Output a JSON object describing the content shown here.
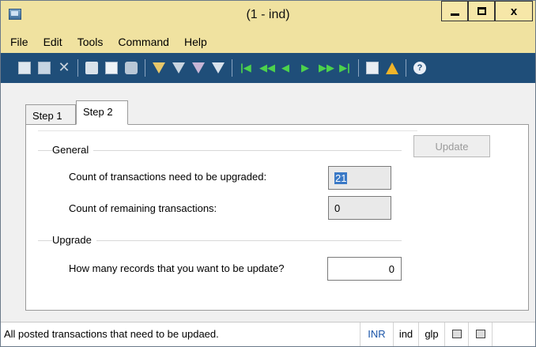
{
  "window": {
    "title": "(1 - ind)",
    "icon": "app-window-icon",
    "controls": {
      "minimize": "minimize-icon",
      "maximize": "maximize-icon",
      "close": "close-icon",
      "close_glyph": "x"
    }
  },
  "menu": {
    "items": [
      {
        "label": "File"
      },
      {
        "label": "Edit"
      },
      {
        "label": "Tools"
      },
      {
        "label": "Command"
      },
      {
        "label": "Help"
      }
    ]
  },
  "toolbar": {
    "icons": [
      "new-record-icon",
      "save-icon",
      "delete-icon",
      "print-icon",
      "print-preview-icon",
      "export-icon",
      "filter-by-selection-icon",
      "filter-icon",
      "advanced-filter-icon",
      "remove-filter-icon",
      "first-record-icon",
      "previous-page-icon",
      "previous-record-icon",
      "next-record-icon",
      "next-page-icon",
      "last-record-icon",
      "attachments-icon",
      "alert-icon",
      "help-icon"
    ],
    "x_glyph": "✕",
    "help_glyph": "?",
    "nav_glyphs": {
      "first": "|◀",
      "prev_page": "◀◀",
      "prev": "◀",
      "next": "▶",
      "next_page": "▶▶",
      "last": "▶|"
    }
  },
  "tabs": [
    {
      "label": "Step 1",
      "active": false
    },
    {
      "label": "Step 2",
      "active": true
    }
  ],
  "form": {
    "update_button": "Update",
    "general": {
      "label": "General",
      "count_upgraded_label": "Count of transactions need to be upgraded:",
      "count_upgraded_value": "21",
      "count_remaining_label": "Count of remaining transactions:",
      "count_remaining_value": "0"
    },
    "upgrade": {
      "label": "Upgrade",
      "records_label": "How many records that you want to be update?",
      "records_value": "0"
    }
  },
  "status": {
    "message": "All posted transactions that need to be updaed.",
    "currency": "INR",
    "company": "ind",
    "layer": "glp",
    "icon1": "session-icon",
    "icon2": "database-icon"
  },
  "colors": {
    "titlebar": "#f0e2a0",
    "toolbar": "#1f4e79",
    "selection": "#3a79c6",
    "currency_text": "#1a55a8"
  }
}
